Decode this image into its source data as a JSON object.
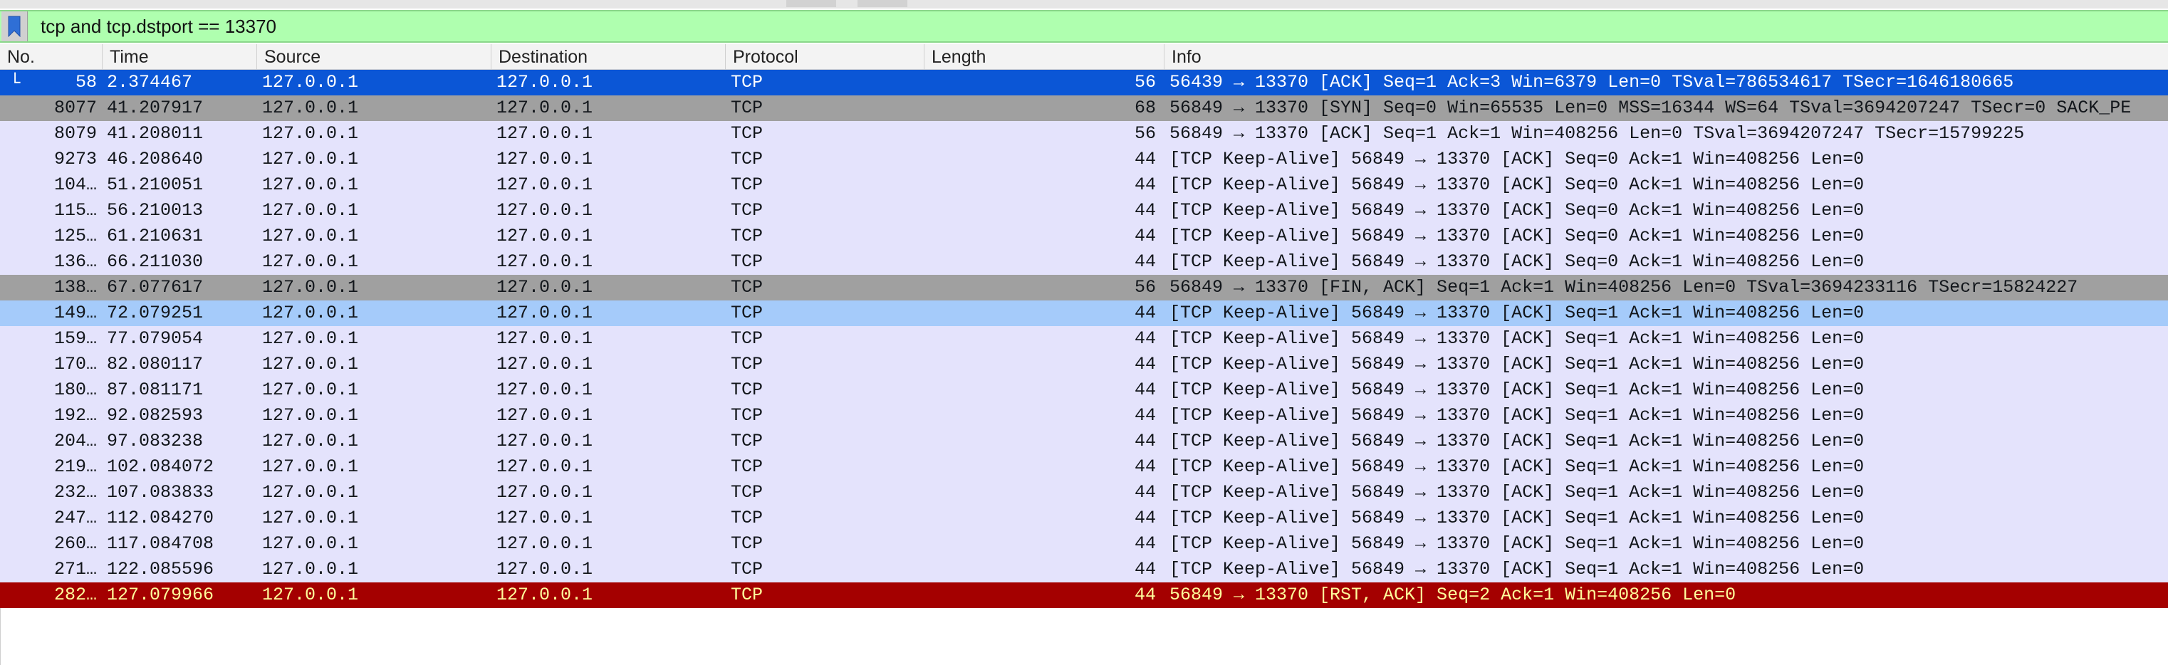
{
  "filter": {
    "text": "tcp and tcp.dstport == 13370",
    "icon": "bookmark-icon",
    "background": "#afffaf"
  },
  "columns": [
    "No.",
    "Time",
    "Source",
    "Destination",
    "Protocol",
    "Length",
    "Info"
  ],
  "row_colors": {
    "selected": "#0b56d6",
    "normal": "#e4e3fc",
    "gray": "#a0a0a0",
    "light_blue": "#a5cbfa",
    "reset": "#a40000"
  },
  "packets": [
    {
      "no": "58",
      "time": "2.374467",
      "source": "127.0.0.1",
      "destination": "127.0.0.1",
      "protocol": "TCP",
      "length": "56",
      "info": "56439 → 13370 [ACK] Seq=1 Ack=3 Win=6379 Len=0 TSval=786534617 TSecr=1646180665",
      "style": "sel",
      "related_mark": "└"
    },
    {
      "no": "8077",
      "time": "41.207917",
      "source": "127.0.0.1",
      "destination": "127.0.0.1",
      "protocol": "TCP",
      "length": "68",
      "info": "56849 → 13370 [SYN] Seq=0 Win=65535 Len=0 MSS=16344 WS=64 TSval=3694207247 TSecr=0 SACK_PE",
      "style": "gray"
    },
    {
      "no": "8079",
      "time": "41.208011",
      "source": "127.0.0.1",
      "destination": "127.0.0.1",
      "protocol": "TCP",
      "length": "56",
      "info": "56849 → 13370 [ACK] Seq=1 Ack=1 Win=408256 Len=0 TSval=3694207247 TSecr=15799225",
      "style": "normal"
    },
    {
      "no": "9273",
      "time": "46.208640",
      "source": "127.0.0.1",
      "destination": "127.0.0.1",
      "protocol": "TCP",
      "length": "44",
      "info": "[TCP Keep-Alive] 56849 → 13370 [ACK] Seq=0 Ack=1 Win=408256 Len=0",
      "style": "normal"
    },
    {
      "no": "104…",
      "time": "51.210051",
      "source": "127.0.0.1",
      "destination": "127.0.0.1",
      "protocol": "TCP",
      "length": "44",
      "info": "[TCP Keep-Alive] 56849 → 13370 [ACK] Seq=0 Ack=1 Win=408256 Len=0",
      "style": "normal"
    },
    {
      "no": "115…",
      "time": "56.210013",
      "source": "127.0.0.1",
      "destination": "127.0.0.1",
      "protocol": "TCP",
      "length": "44",
      "info": "[TCP Keep-Alive] 56849 → 13370 [ACK] Seq=0 Ack=1 Win=408256 Len=0",
      "style": "normal"
    },
    {
      "no": "125…",
      "time": "61.210631",
      "source": "127.0.0.1",
      "destination": "127.0.0.1",
      "protocol": "TCP",
      "length": "44",
      "info": "[TCP Keep-Alive] 56849 → 13370 [ACK] Seq=0 Ack=1 Win=408256 Len=0",
      "style": "normal"
    },
    {
      "no": "136…",
      "time": "66.211030",
      "source": "127.0.0.1",
      "destination": "127.0.0.1",
      "protocol": "TCP",
      "length": "44",
      "info": "[TCP Keep-Alive] 56849 → 13370 [ACK] Seq=0 Ack=1 Win=408256 Len=0",
      "style": "normal"
    },
    {
      "no": "138…",
      "time": "67.077617",
      "source": "127.0.0.1",
      "destination": "127.0.0.1",
      "protocol": "TCP",
      "length": "56",
      "info": "56849 → 13370 [FIN, ACK] Seq=1 Ack=1 Win=408256 Len=0 TSval=3694233116 TSecr=15824227",
      "style": "gray"
    },
    {
      "no": "149…",
      "time": "72.079251",
      "source": "127.0.0.1",
      "destination": "127.0.0.1",
      "protocol": "TCP",
      "length": "44",
      "info": "[TCP Keep-Alive] 56849 → 13370 [ACK] Seq=1 Ack=1 Win=408256 Len=0",
      "style": "light"
    },
    {
      "no": "159…",
      "time": "77.079054",
      "source": "127.0.0.1",
      "destination": "127.0.0.1",
      "protocol": "TCP",
      "length": "44",
      "info": "[TCP Keep-Alive] 56849 → 13370 [ACK] Seq=1 Ack=1 Win=408256 Len=0",
      "style": "normal"
    },
    {
      "no": "170…",
      "time": "82.080117",
      "source": "127.0.0.1",
      "destination": "127.0.0.1",
      "protocol": "TCP",
      "length": "44",
      "info": "[TCP Keep-Alive] 56849 → 13370 [ACK] Seq=1 Ack=1 Win=408256 Len=0",
      "style": "normal"
    },
    {
      "no": "180…",
      "time": "87.081171",
      "source": "127.0.0.1",
      "destination": "127.0.0.1",
      "protocol": "TCP",
      "length": "44",
      "info": "[TCP Keep-Alive] 56849 → 13370 [ACK] Seq=1 Ack=1 Win=408256 Len=0",
      "style": "normal"
    },
    {
      "no": "192…",
      "time": "92.082593",
      "source": "127.0.0.1",
      "destination": "127.0.0.1",
      "protocol": "TCP",
      "length": "44",
      "info": "[TCP Keep-Alive] 56849 → 13370 [ACK] Seq=1 Ack=1 Win=408256 Len=0",
      "style": "normal"
    },
    {
      "no": "204…",
      "time": "97.083238",
      "source": "127.0.0.1",
      "destination": "127.0.0.1",
      "protocol": "TCP",
      "length": "44",
      "info": "[TCP Keep-Alive] 56849 → 13370 [ACK] Seq=1 Ack=1 Win=408256 Len=0",
      "style": "normal"
    },
    {
      "no": "219…",
      "time": "102.084072",
      "source": "127.0.0.1",
      "destination": "127.0.0.1",
      "protocol": "TCP",
      "length": "44",
      "info": "[TCP Keep-Alive] 56849 → 13370 [ACK] Seq=1 Ack=1 Win=408256 Len=0",
      "style": "normal"
    },
    {
      "no": "232…",
      "time": "107.083833",
      "source": "127.0.0.1",
      "destination": "127.0.0.1",
      "protocol": "TCP",
      "length": "44",
      "info": "[TCP Keep-Alive] 56849 → 13370 [ACK] Seq=1 Ack=1 Win=408256 Len=0",
      "style": "normal"
    },
    {
      "no": "247…",
      "time": "112.084270",
      "source": "127.0.0.1",
      "destination": "127.0.0.1",
      "protocol": "TCP",
      "length": "44",
      "info": "[TCP Keep-Alive] 56849 → 13370 [ACK] Seq=1 Ack=1 Win=408256 Len=0",
      "style": "normal"
    },
    {
      "no": "260…",
      "time": "117.084708",
      "source": "127.0.0.1",
      "destination": "127.0.0.1",
      "protocol": "TCP",
      "length": "44",
      "info": "[TCP Keep-Alive] 56849 → 13370 [ACK] Seq=1 Ack=1 Win=408256 Len=0",
      "style": "normal"
    },
    {
      "no": "271…",
      "time": "122.085596",
      "source": "127.0.0.1",
      "destination": "127.0.0.1",
      "protocol": "TCP",
      "length": "44",
      "info": "[TCP Keep-Alive] 56849 → 13370 [ACK] Seq=1 Ack=1 Win=408256 Len=0",
      "style": "normal"
    },
    {
      "no": "282…",
      "time": "127.079966",
      "source": "127.0.0.1",
      "destination": "127.0.0.1",
      "protocol": "TCP",
      "length": "44",
      "info": "56849 → 13370 [RST, ACK] Seq=2 Ack=1 Win=408256 Len=0",
      "style": "red"
    }
  ]
}
